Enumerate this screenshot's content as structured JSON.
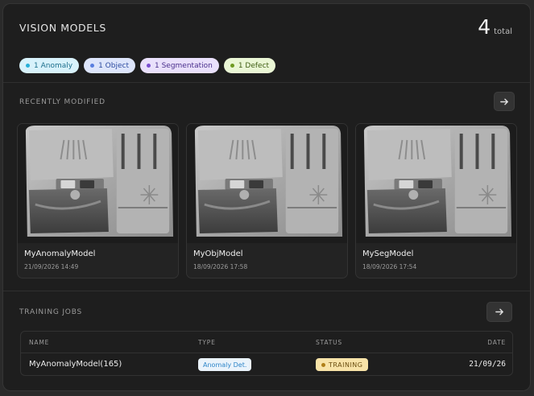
{
  "header": {
    "title": "VISION MODELS",
    "count": "4",
    "count_label": "total"
  },
  "chips": [
    {
      "label": "1 Anomaly",
      "bg": "#d8f2fb",
      "fg": "#1d6f8c",
      "dot": "#28b0d8"
    },
    {
      "label": "1 Object",
      "bg": "#dde5fb",
      "fg": "#2f4da0",
      "dot": "#5a7fe0"
    },
    {
      "label": "1 Segmentation",
      "bg": "#e9e0fb",
      "fg": "#4a2f8c",
      "dot": "#7a4fd0"
    },
    {
      "label": "1 Defect",
      "bg": "#eaf6d5",
      "fg": "#3f5d14",
      "dot": "#6f9a22"
    }
  ],
  "recent": {
    "title": "RECENTLY MODIFIED",
    "cards": [
      {
        "name": "MyAnomalyModel",
        "date": "21/09/2026 14:49"
      },
      {
        "name": "MyObjModel",
        "date": "18/09/2026 17:58"
      },
      {
        "name": "MySegModel",
        "date": "18/09/2026 17:54"
      }
    ]
  },
  "training": {
    "title": "TRAINING JOBS",
    "columns": {
      "name": "NAME",
      "type": "TYPE",
      "status": "STATUS",
      "date": "DATE"
    },
    "rows": [
      {
        "name": "MyAnomalyModel(165)",
        "type": "Anomaly Det.",
        "status": "TRAINING",
        "date": "21/09/26"
      }
    ]
  }
}
